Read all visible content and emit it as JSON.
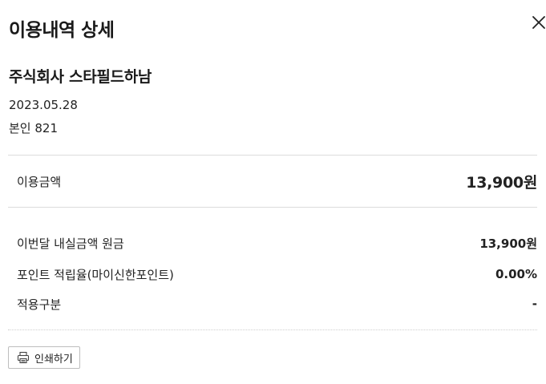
{
  "modal": {
    "title": "이용내역 상세",
    "close_icon": "close-icon"
  },
  "transaction": {
    "merchant": "주식회사 스타필드하남",
    "date": "2023.05.28",
    "card": "본인 821"
  },
  "amount": {
    "label": "이용금액",
    "value": "13,900원"
  },
  "details": [
    {
      "label": "이번달 내실금액 원금",
      "value": "13,900원"
    },
    {
      "label": "포인트 적립율(마이신한포인트)",
      "value": "0.00%"
    },
    {
      "label": "적용구분",
      "value": "-"
    }
  ],
  "print": {
    "label": "인쇄하기",
    "icon": "printer-icon"
  }
}
